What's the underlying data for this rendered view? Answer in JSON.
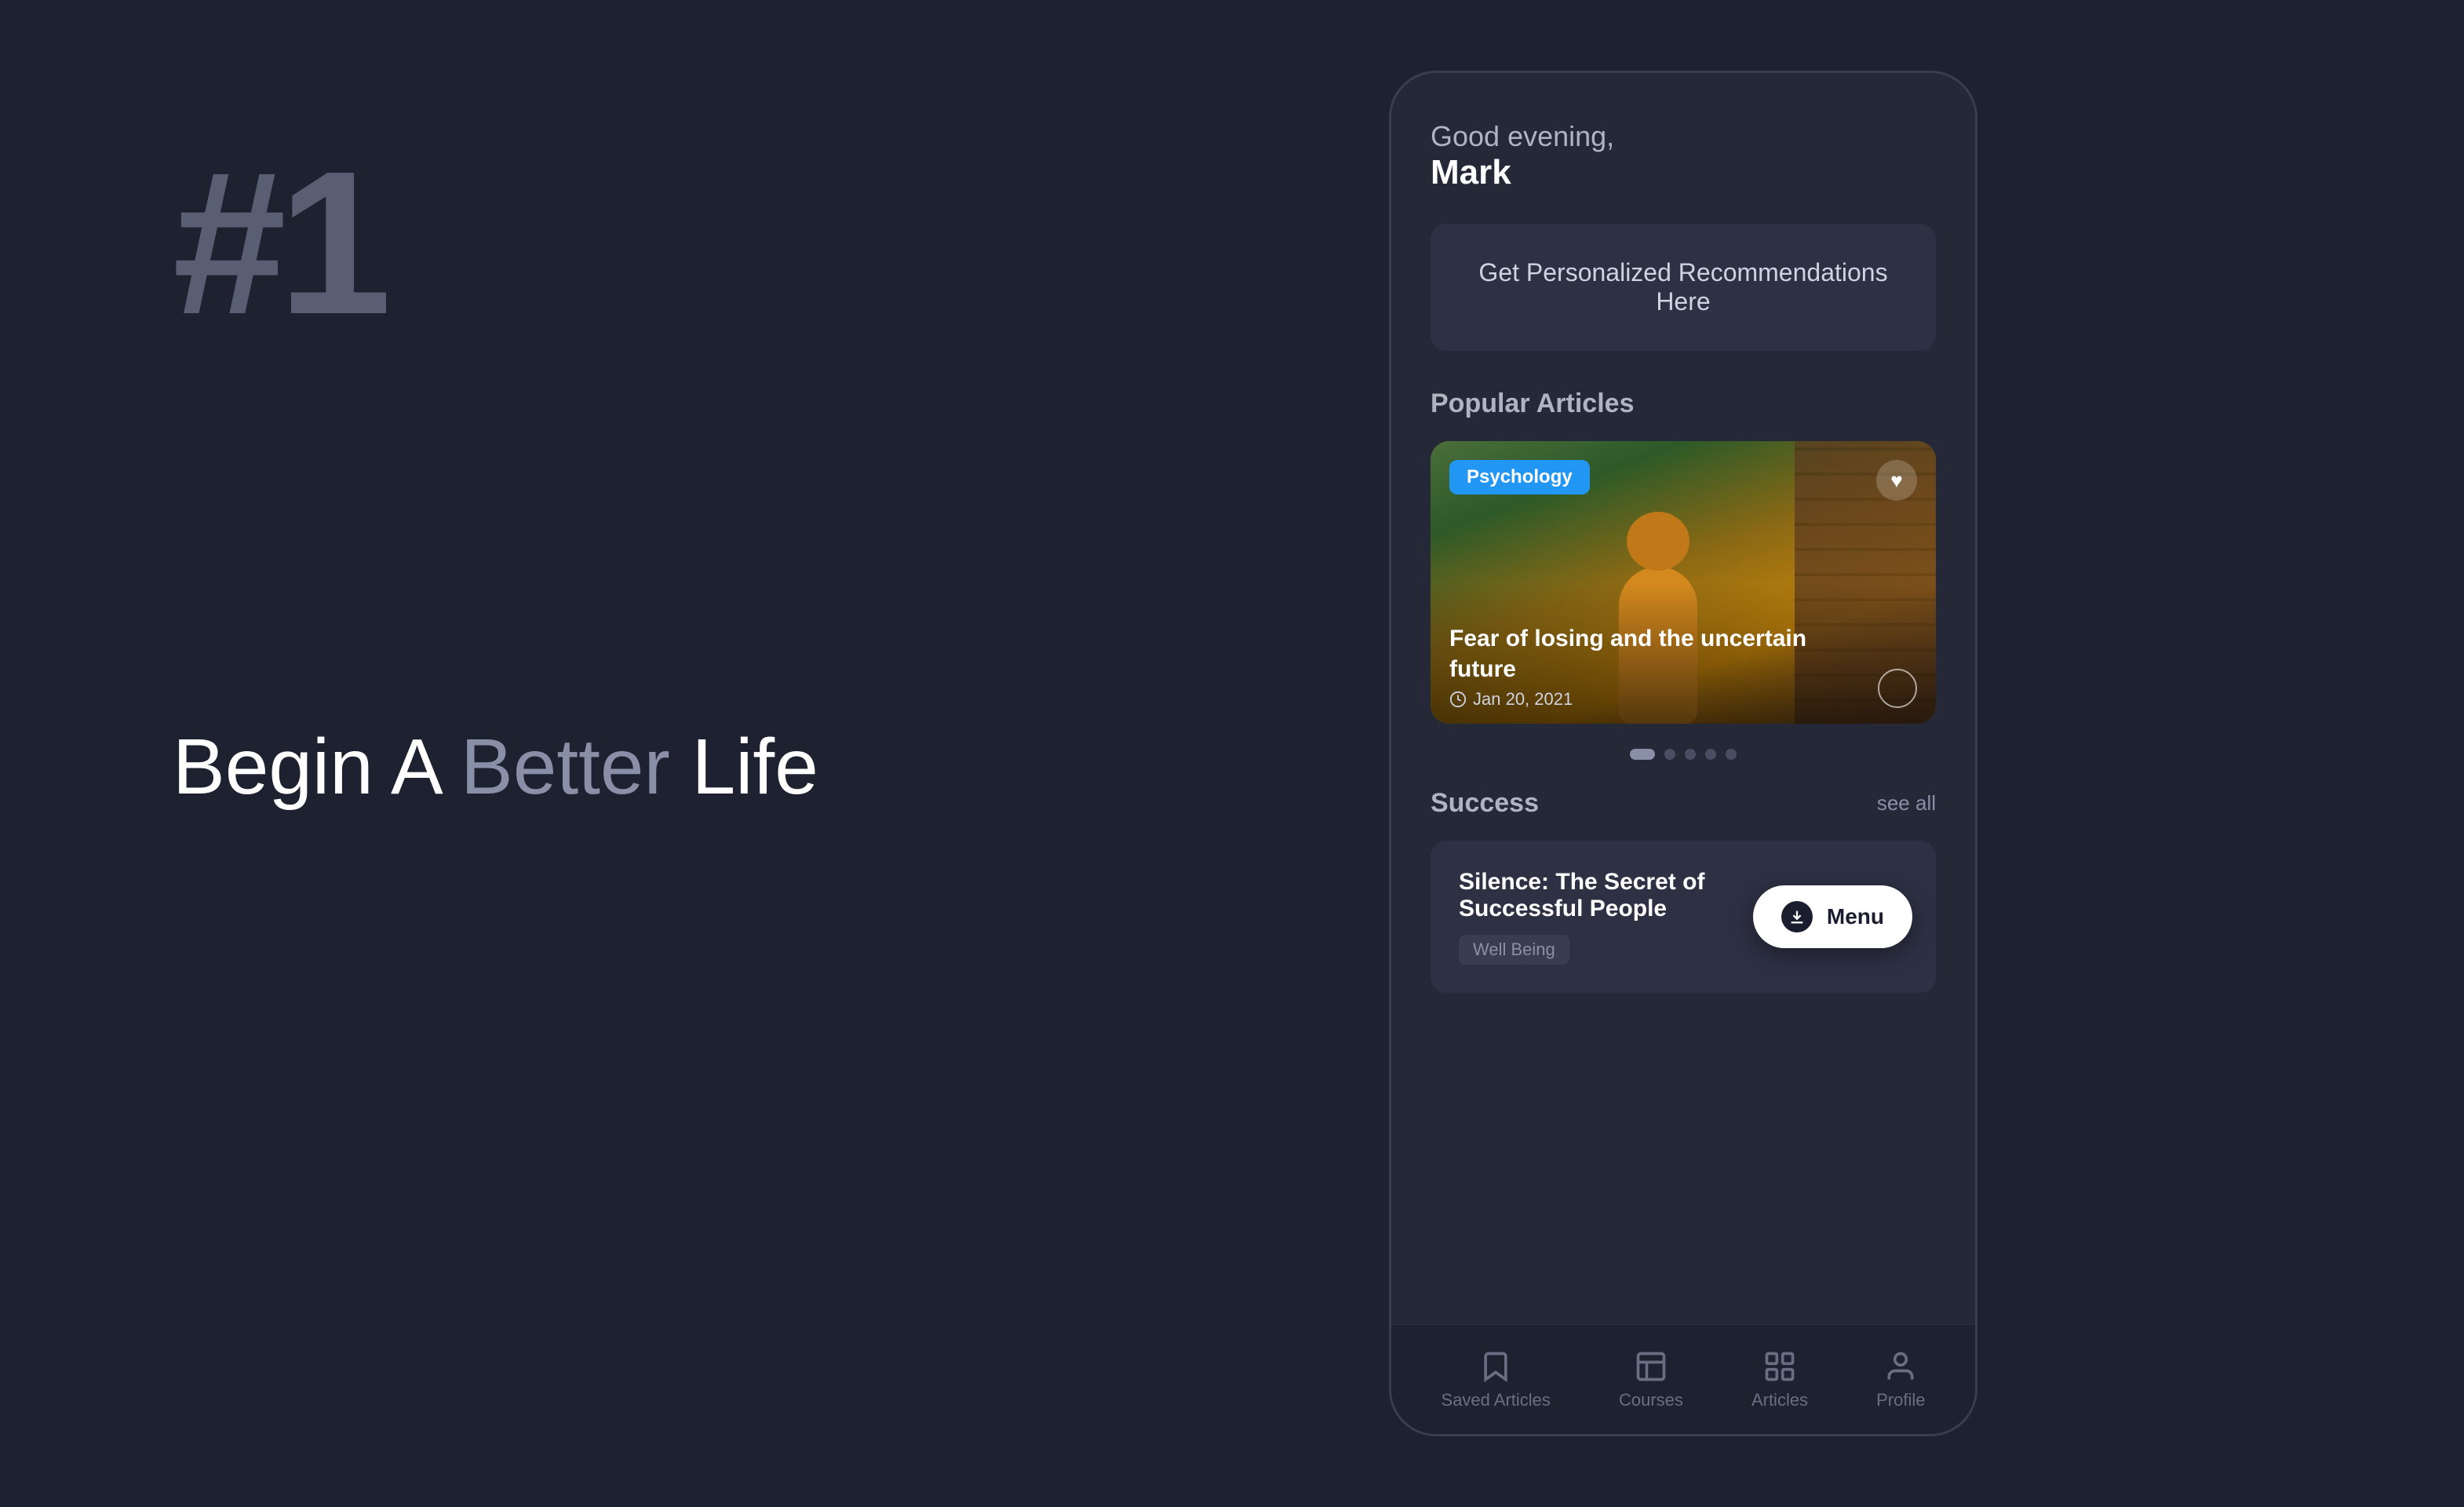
{
  "left": {
    "rank": "#1",
    "tagline_start": "Begin A ",
    "tagline_highlight": "Better",
    "tagline_end": " Life"
  },
  "phone": {
    "greeting_sub": "Good evening,",
    "greeting_name": "Mark",
    "banner": {
      "label": "Get Personalized Recommendations Here"
    },
    "popular_articles": {
      "section_title": "Popular Articles",
      "featured": {
        "category": "Psychology",
        "title": "Fear of losing and the uncertain future",
        "date": "Jan 20, 2021"
      },
      "dots": [
        true,
        false,
        false,
        false,
        false
      ]
    },
    "success": {
      "section_title": "Success",
      "see_all": "see all",
      "article": {
        "title": "Silence: The Secret of Successful People",
        "tag": "Well Being"
      }
    },
    "menu_button": {
      "label": "Menu"
    },
    "bottom_nav": [
      {
        "label": "Saved Articles",
        "icon": "bookmark"
      },
      {
        "label": "Courses",
        "icon": "book-open"
      },
      {
        "label": "Articles",
        "icon": "grid"
      },
      {
        "label": "Profile",
        "icon": "user"
      }
    ]
  }
}
